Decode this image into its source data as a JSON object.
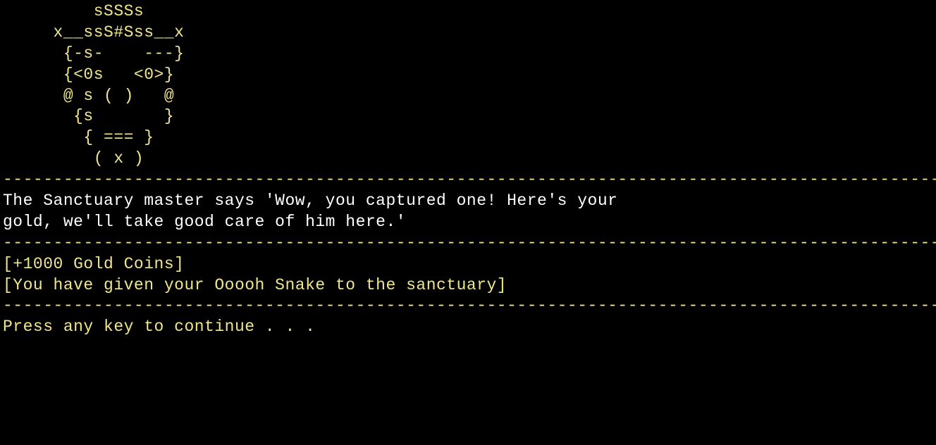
{
  "art": {
    "line1": "         sSSSs",
    "line2": "     x__ssS#Sss__x",
    "line3": "      {-s-    ---}",
    "line4": "      {<0s   <0>}",
    "line5": "      @ s ( )   @",
    "line6": "       {s       }",
    "line7": "        { === }",
    "line8": "         ( x )"
  },
  "divider": "---------------------------------------------------------------------------------------------",
  "dialogue": {
    "line1": "The Sanctuary master says 'Wow, you captured one! Here's your",
    "line2": "gold, we'll take good care of him here.'"
  },
  "status": {
    "gold": "[+1000 Gold Coins]",
    "action": "[You have given your Ooooh Snake to the sanctuary]"
  },
  "prompt": "Press any key to continue . . ."
}
